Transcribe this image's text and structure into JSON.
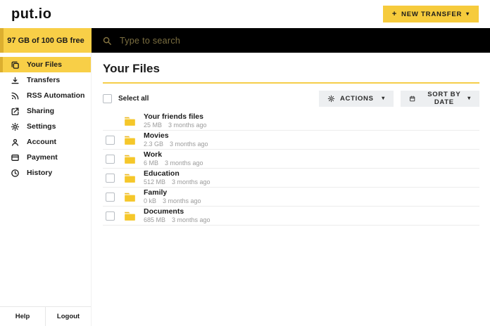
{
  "header": {
    "logo": "put.io",
    "new_transfer": {
      "plus": "+",
      "label": "NEW TRANSFER",
      "caret": "▾"
    }
  },
  "storage": {
    "label": "97 GB of 100 GB free"
  },
  "search": {
    "placeholder": "Type to search"
  },
  "sidebar": {
    "items": [
      {
        "label": "Your Files",
        "icon": "files",
        "active": true
      },
      {
        "label": "Transfers",
        "icon": "transfers",
        "active": false
      },
      {
        "label": "RSS Automation",
        "icon": "rss",
        "active": false
      },
      {
        "label": "Sharing",
        "icon": "sharing",
        "active": false
      },
      {
        "label": "Settings",
        "icon": "settings",
        "active": false
      },
      {
        "label": "Account",
        "icon": "account",
        "active": false
      },
      {
        "label": "Payment",
        "icon": "payment",
        "active": false
      },
      {
        "label": "History",
        "icon": "history",
        "active": false
      }
    ],
    "help_label": "Help",
    "logout_label": "Logout"
  },
  "main": {
    "title": "Your Files",
    "select_all_label": "Select all",
    "actions": {
      "label": "ACTIONS",
      "caret": "▾"
    },
    "sort": {
      "label": "SORT BY DATE",
      "caret": "▾"
    },
    "files": [
      {
        "name": "Your friends files",
        "size": "25 MB",
        "age": "3 months ago",
        "selectable": false
      },
      {
        "name": "Movies",
        "size": "2.3 GB",
        "age": "3 months ago",
        "selectable": true
      },
      {
        "name": "Work",
        "size": "6 MB",
        "age": "3 months ago",
        "selectable": true
      },
      {
        "name": "Education",
        "size": "512 MB",
        "age": "3 months ago",
        "selectable": true
      },
      {
        "name": "Family",
        "size": "0 kB",
        "age": "3 months ago",
        "selectable": true
      },
      {
        "name": "Documents",
        "size": "685 MB",
        "age": "3 months ago",
        "selectable": true
      }
    ]
  },
  "colors": {
    "brand_yellow": "#F8CF47",
    "brand_yellow_dark": "#DCAF2F",
    "search_bg": "#000000",
    "button_gray": "#EDEFF1",
    "muted_text": "#9B9B9B",
    "folder_yellow": "#F5C72A"
  }
}
